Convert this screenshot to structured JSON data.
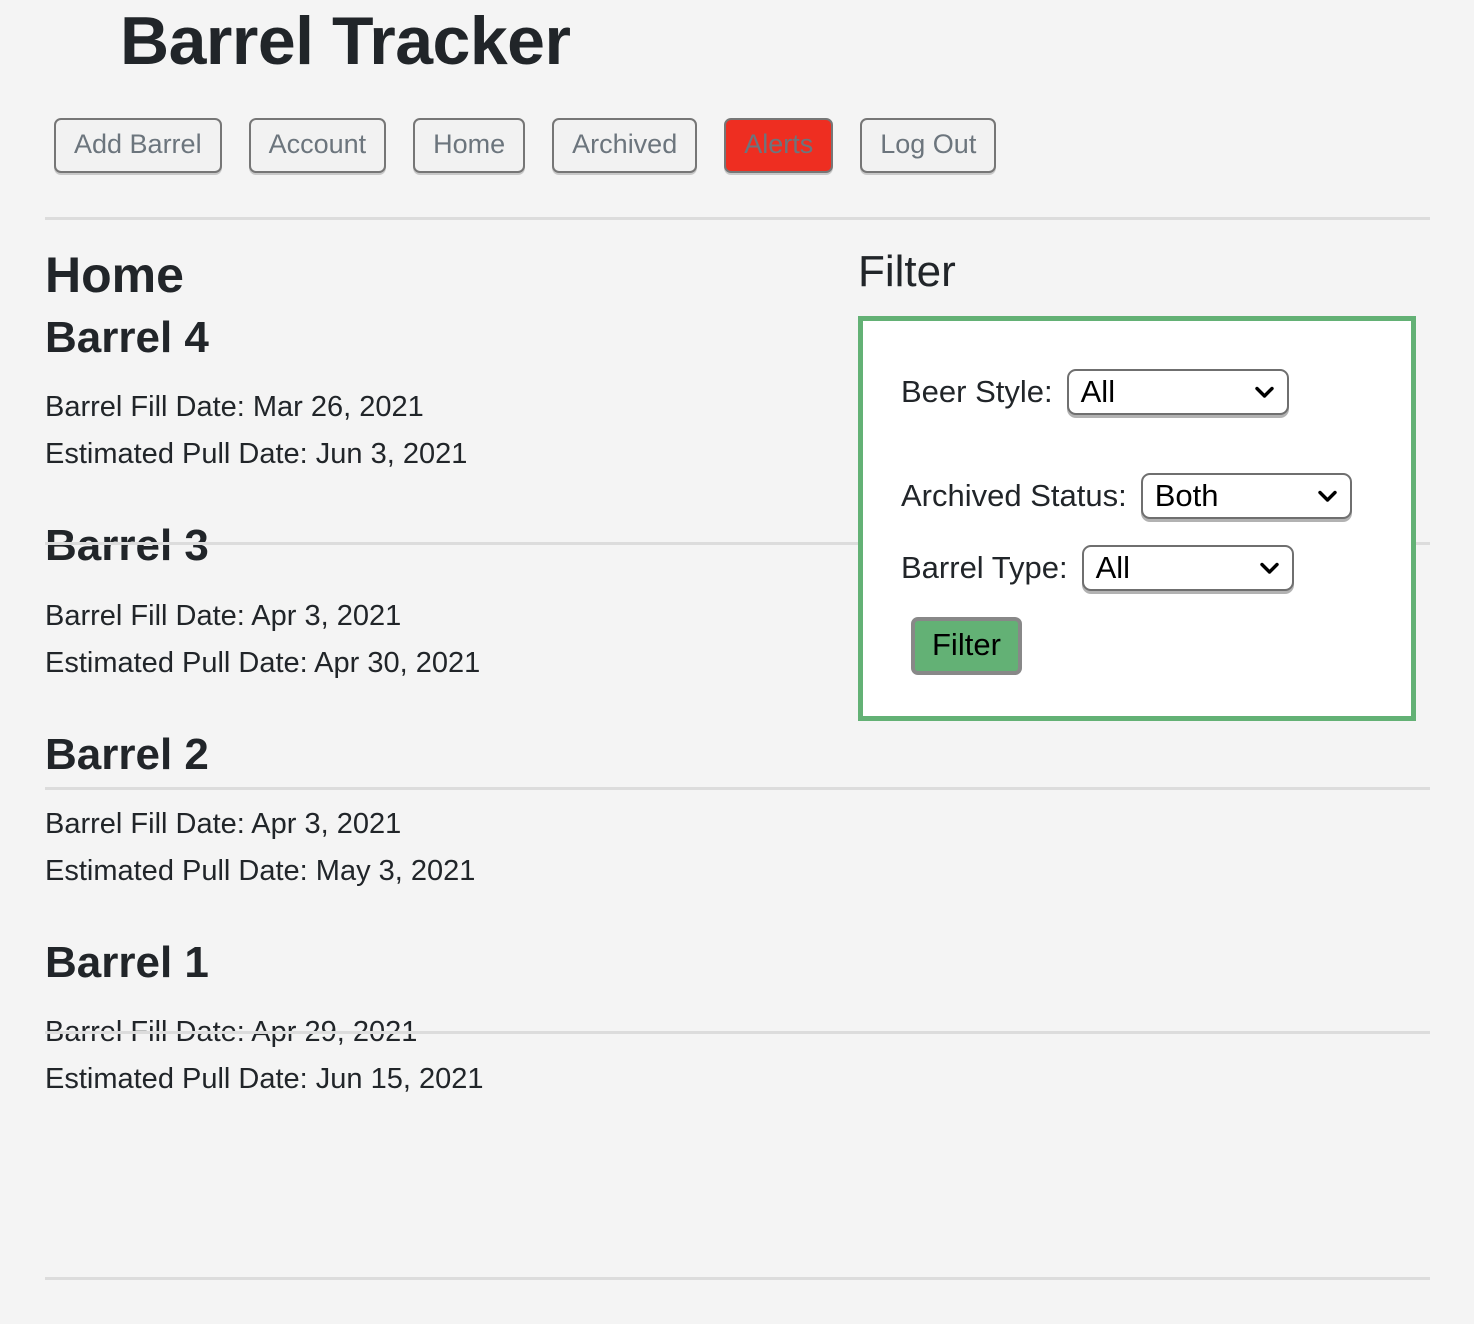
{
  "app": {
    "title": "Barrel Tracker",
    "background_color": "#f4f4f4",
    "accent_green": "#63b175",
    "alert_red": "#ee2e21"
  },
  "nav": {
    "items": [
      {
        "label": "Add Barrel",
        "style": "default"
      },
      {
        "label": "Account",
        "style": "default"
      },
      {
        "label": "Home",
        "style": "default"
      },
      {
        "label": "Archived",
        "style": "default"
      },
      {
        "label": "Alerts",
        "style": "alert"
      },
      {
        "label": "Log Out",
        "style": "default"
      }
    ]
  },
  "main": {
    "heading": "Home",
    "barrels": [
      {
        "name": "Barrel 4",
        "fill_date_line": "Barrel Fill Date: Mar 26, 2021",
        "pull_date_line": "Estimated Pull Date: Jun 3, 2021"
      },
      {
        "name": "Barrel 3",
        "fill_date_line": "Barrel Fill Date: Apr 3, 2021",
        "pull_date_line": "Estimated Pull Date: Apr 30, 2021"
      },
      {
        "name": "Barrel 2",
        "fill_date_line": "Barrel Fill Date: Apr 3, 2021",
        "pull_date_line": "Estimated Pull Date: May 3, 2021"
      },
      {
        "name": "Barrel 1",
        "fill_date_line": "Barrel Fill Date: Apr 29, 2021",
        "pull_date_line": "Estimated Pull Date: Jun 15, 2021"
      }
    ]
  },
  "filter": {
    "heading": "Filter",
    "beer_style": {
      "label": "Beer Style:",
      "value": "All"
    },
    "archived_status": {
      "label": "Archived Status:",
      "value": "Both"
    },
    "barrel_type": {
      "label": "Barrel Type:",
      "value": "All"
    },
    "submit_label": "Filter"
  }
}
